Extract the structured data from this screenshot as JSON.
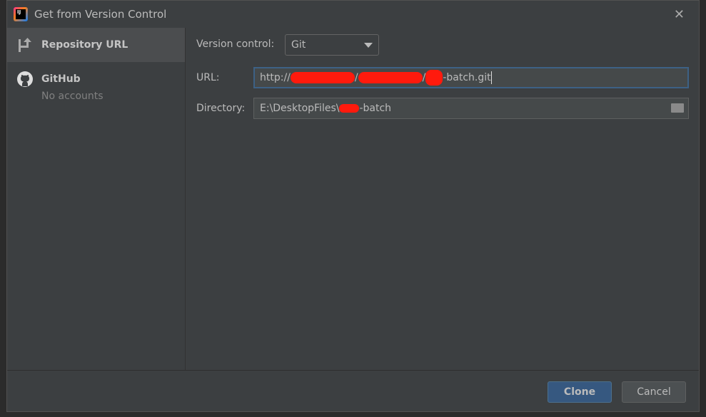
{
  "window": {
    "title": "Get from Version Control",
    "close_icon": "close-icon"
  },
  "sidebar": {
    "items": [
      {
        "label": "Repository URL",
        "icon": "repository-url-icon"
      },
      {
        "label": "GitHub",
        "icon": "github-icon",
        "sublabel": "No accounts"
      }
    ]
  },
  "form": {
    "version_control": {
      "label": "Version control:",
      "value": "Git"
    },
    "url": {
      "label": "URL:",
      "prefix": "http://",
      "sep1": "/",
      "sep2": "/",
      "suffix": "-batch.git"
    },
    "directory": {
      "label": "Directory:",
      "prefix": "E:\\DesktopFiles\\",
      "suffix": "-batch"
    }
  },
  "footer": {
    "clone": "Clone",
    "cancel": "Cancel"
  },
  "colors": {
    "accent": "#365880",
    "focus_border": "#3d6185",
    "redaction": "#ff1a0d"
  }
}
